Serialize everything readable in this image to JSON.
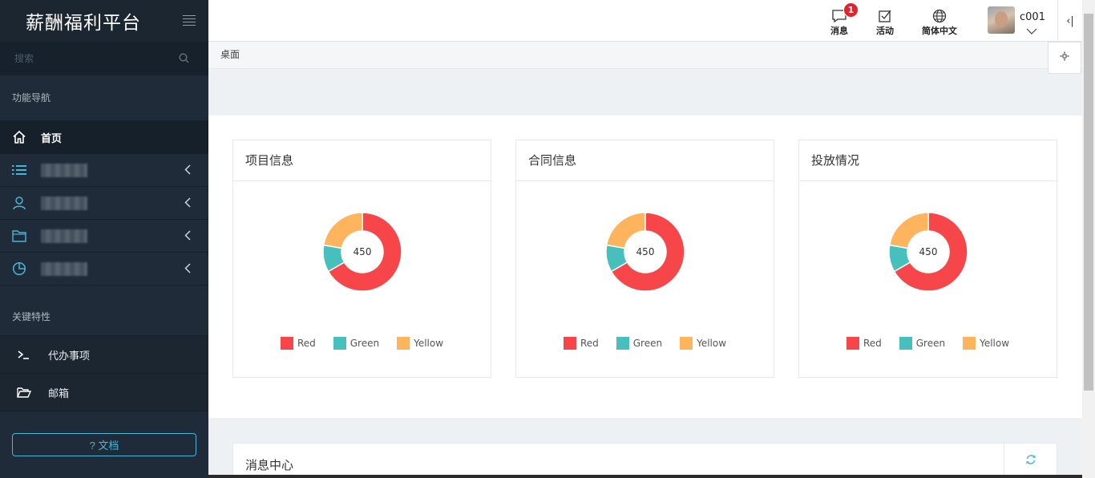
{
  "sidebar": {
    "title": "薪酬福利平台",
    "search_placeholder": "搜索",
    "section_nav": "功能导航",
    "nav_items": [
      {
        "label": "首页",
        "icon": "home-icon"
      },
      {
        "label": "",
        "icon": "list-icon"
      },
      {
        "label": "",
        "icon": "user-icon"
      },
      {
        "label": "",
        "icon": "folder-icon"
      },
      {
        "label": "",
        "icon": "pie-chart-icon"
      }
    ],
    "section_features": "关键特性",
    "feature_items": [
      {
        "label": "代办事项",
        "icon": "terminal-icon"
      },
      {
        "label": "邮箱",
        "icon": "folder-open-icon"
      }
    ],
    "doc_button": "? 文档"
  },
  "header": {
    "messages_label": "消息",
    "messages_badge": "1",
    "activity_label": "活动",
    "language_label": "简体中文",
    "username": "c001",
    "collapse_label": "‹|"
  },
  "breadcrumb": "桌面",
  "cards": [
    {
      "title": "项目信息",
      "center": "450"
    },
    {
      "title": "合同信息",
      "center": "450"
    },
    {
      "title": "投放情况",
      "center": "450"
    }
  ],
  "legend": [
    "Red",
    "Green",
    "Yellow"
  ],
  "chart_data": {
    "type": "pie",
    "categories": [
      "Red",
      "Green",
      "Yellow"
    ],
    "values": [
      300,
      50,
      100
    ],
    "center_label": "450"
  },
  "colors": {
    "red": "#f7464a",
    "green": "#46bfbd",
    "yellow": "#fdb45c",
    "accent": "#48b6d6",
    "sidebar_bg": "#1f2b38"
  },
  "message_center": {
    "title": "消息中心"
  }
}
